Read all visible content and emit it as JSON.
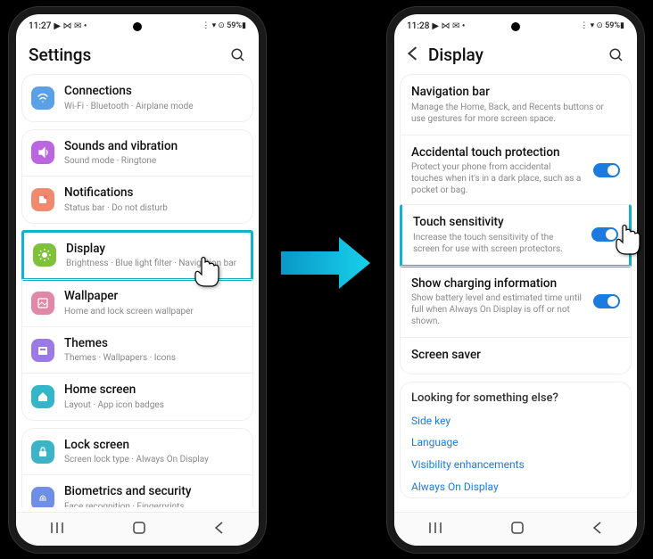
{
  "left": {
    "status": {
      "time": "11:27",
      "icons": "▶ ⋈ ✉ •",
      "right": "⋮ ▾ ⊙ 59%▮"
    },
    "header": {
      "title": "Settings"
    },
    "rows": [
      {
        "icon": "wifi",
        "bg": "#5aa0e6",
        "title": "Connections",
        "sub": "Wi-Fi · Bluetooth · Airplane mode"
      },
      {
        "icon": "sound",
        "bg": "#bb66e0",
        "title": "Sounds and vibration",
        "sub": "Sound mode · Ringtone"
      },
      {
        "icon": "notif",
        "bg": "#ef8a6e",
        "title": "Notifications",
        "sub": "Status bar · Do not disturb"
      },
      {
        "icon": "display",
        "bg": "#7fc23a",
        "title": "Display",
        "sub": "Brightness · Blue light filter · Navigation bar",
        "highlight": true
      },
      {
        "icon": "wallpaper",
        "bg": "#e088a6",
        "title": "Wallpaper",
        "sub": "Home and lock screen wallpaper"
      },
      {
        "icon": "themes",
        "bg": "#9a7be5",
        "title": "Themes",
        "sub": "Themes · Wallpapers · Icons"
      },
      {
        "icon": "home",
        "bg": "#33b6c7",
        "title": "Home screen",
        "sub": "Layout · App icon badges"
      },
      {
        "icon": "lock",
        "bg": "#3cb4c8",
        "title": "Lock screen",
        "sub": "Screen lock type · Always On Display"
      },
      {
        "icon": "biometrics",
        "bg": "#6f8ee6",
        "title": "Biometrics and security",
        "sub": "Face recognition · Fingerprints"
      }
    ]
  },
  "right": {
    "status": {
      "time": "11:28",
      "icons": "▶ ⋈ ✉ •",
      "right": "⋮ ▾ ⊙ 59%▮"
    },
    "header": {
      "title": "Display"
    },
    "items": [
      {
        "title": "Navigation bar",
        "sub": "Manage the Home, Back, and Recents buttons or use gestures for more screen space."
      },
      {
        "title": "Accidental touch protection",
        "sub": "Protect your phone from accidental touches when it's in a dark place, such as a pocket or bag.",
        "toggle": true
      },
      {
        "title": "Touch sensitivity",
        "sub": "Increase the touch sensitivity of the screen for use with screen protectors.",
        "toggle": true,
        "highlight": true
      },
      {
        "title": "Show charging information",
        "sub": "Show battery level and estimated time until full when Always On Display is off or not shown.",
        "toggle": true
      },
      {
        "title": "Screen saver"
      }
    ],
    "more": {
      "label": "Looking for something else?",
      "links": [
        "Side key",
        "Language",
        "Visibility enhancements",
        "Always On Display"
      ]
    }
  },
  "nav": {
    "recents": "⦀",
    "home": "▢",
    "back": "⟨"
  }
}
